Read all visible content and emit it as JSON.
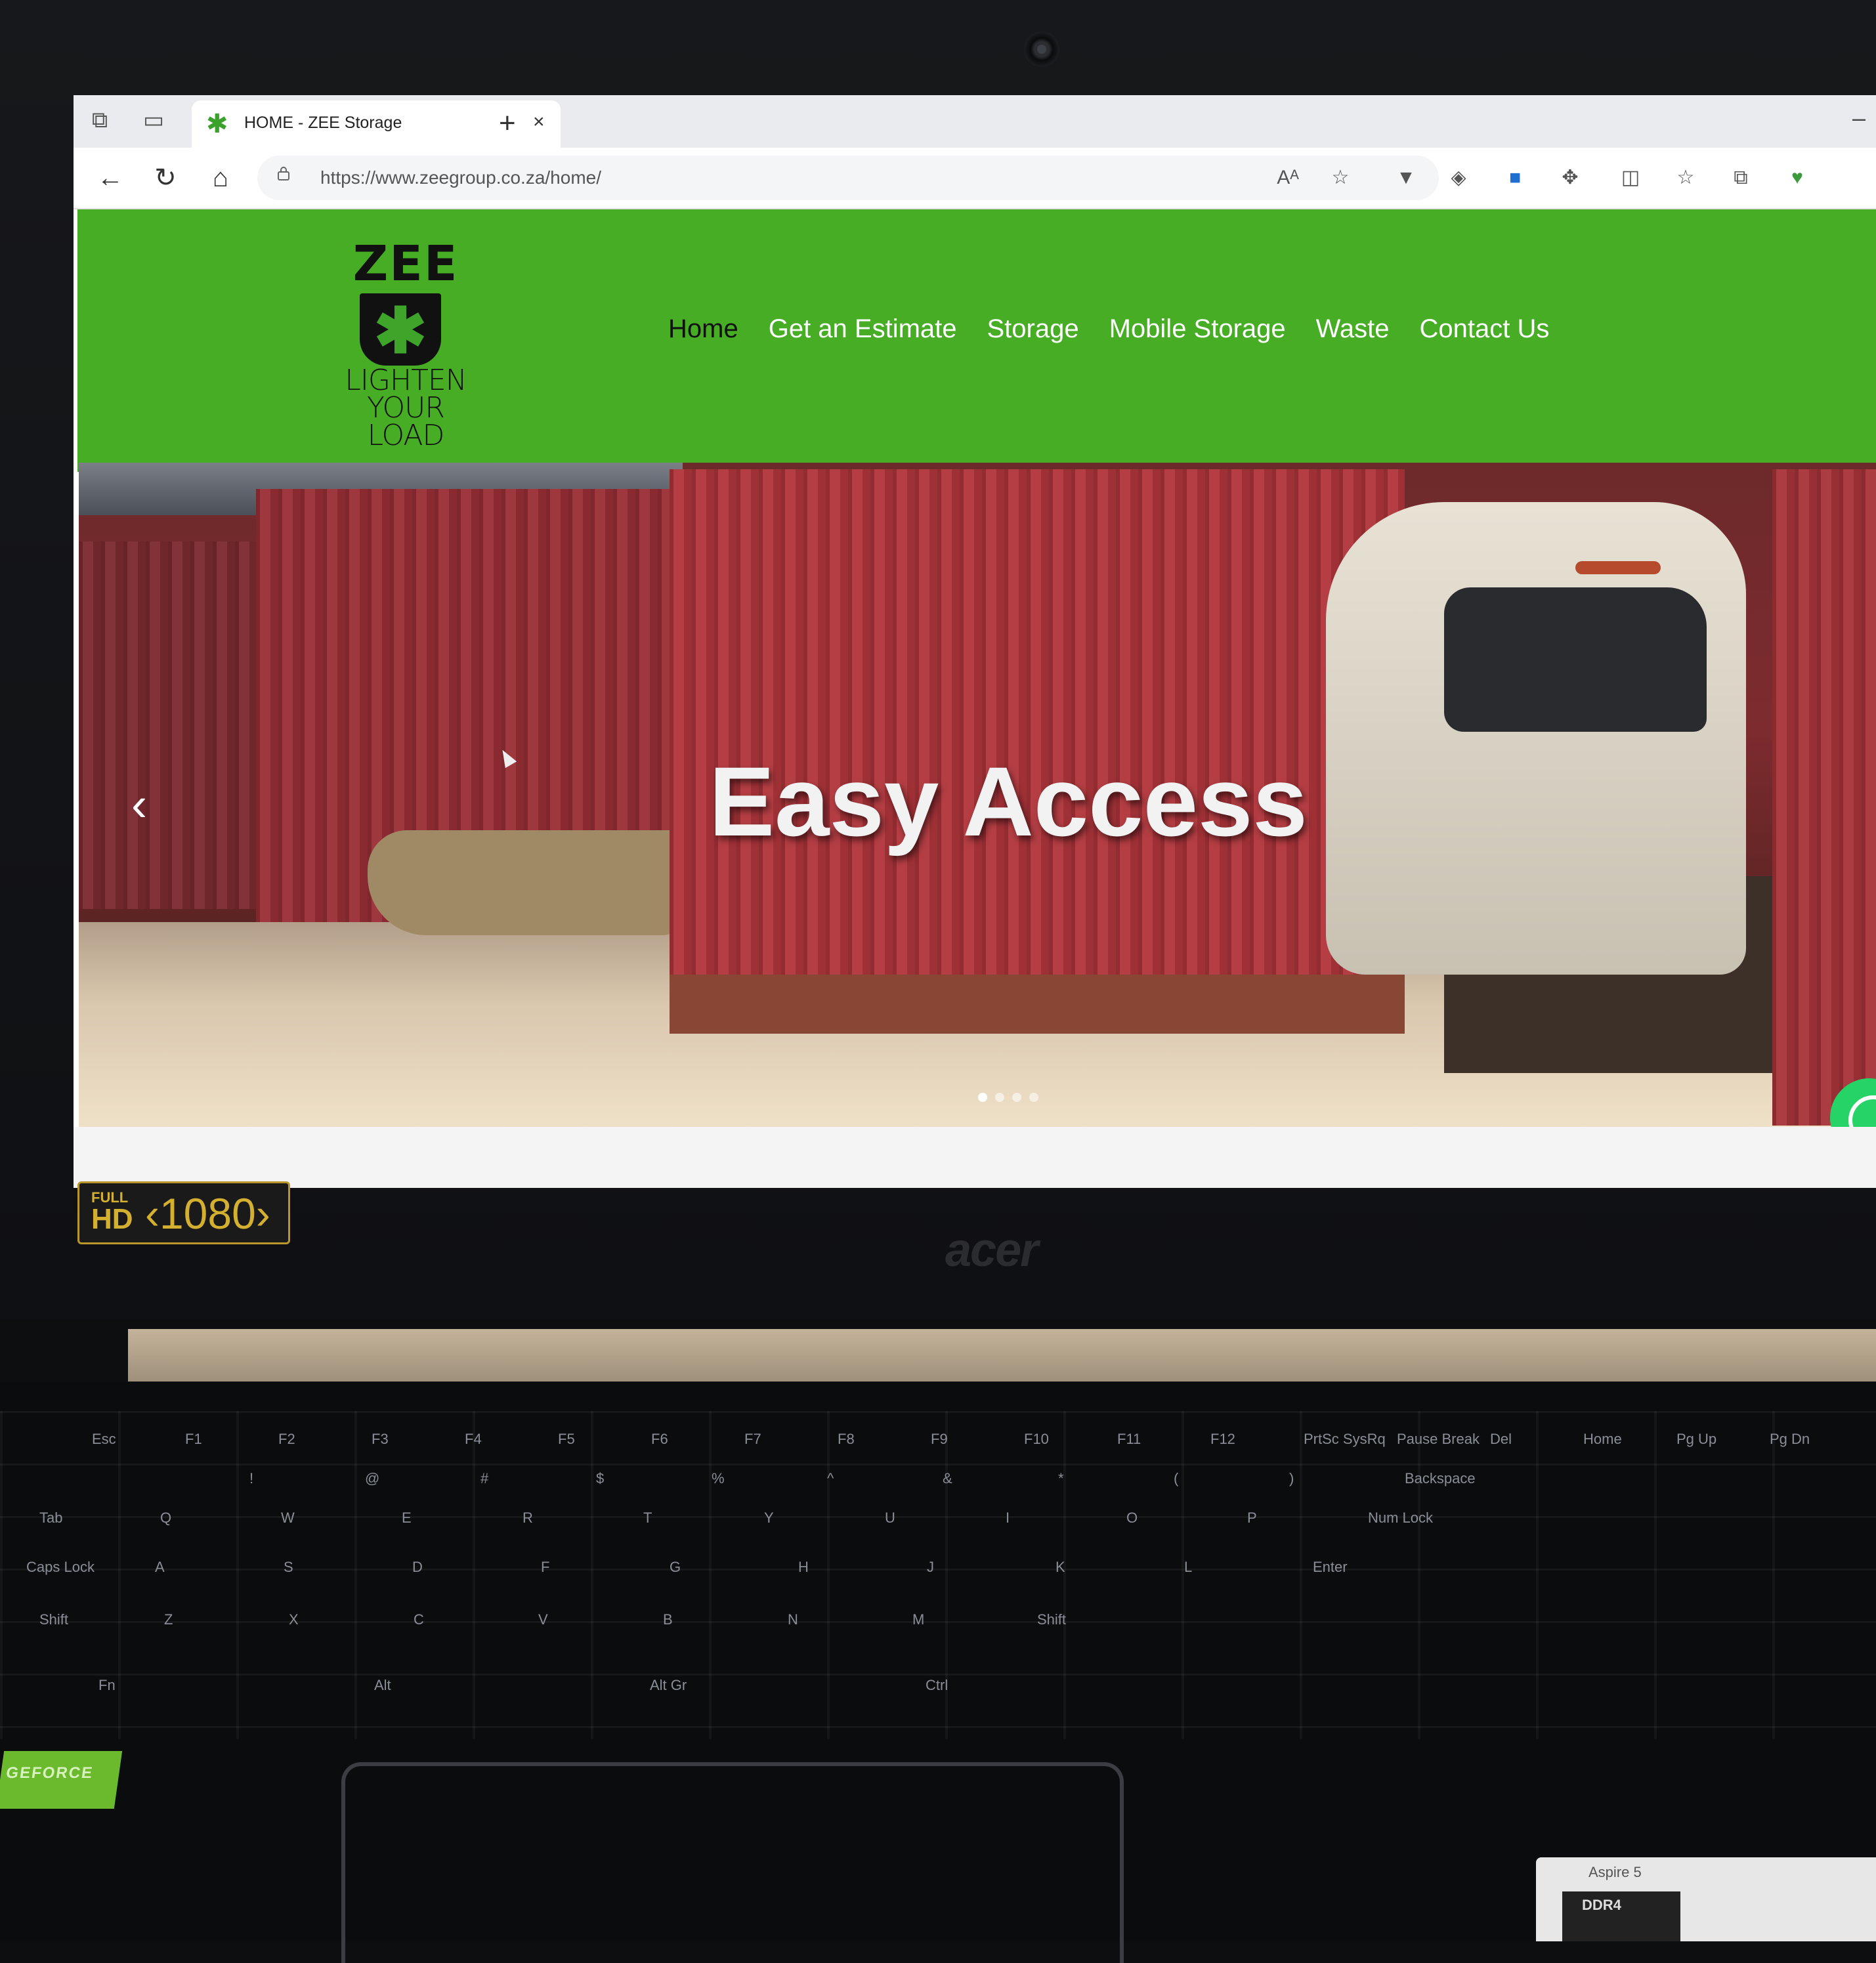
{
  "browser": {
    "tab_title": "HOME - ZEE Storage",
    "tab_close": "×",
    "new_tab": "+",
    "url": "https://www.zeegroup.co.za/home/",
    "icons": [
      "workspaces-icon",
      "tab-actions-icon",
      "back-icon",
      "refresh-icon",
      "home-icon",
      "lock-icon",
      "read-aloud-icon",
      "favorite-star-icon",
      "vivaldi-extension-icon",
      "extension-icon",
      "shield-extension-icon",
      "extensions-icon",
      "split-screen-icon",
      "favorites-icon",
      "collections-icon",
      "heart-extension-icon"
    ]
  },
  "site": {
    "logo": {
      "wordmark": "ZEE",
      "tagline_lines": [
        "LIGHTEN",
        "YOUR",
        "LOAD"
      ]
    },
    "nav": [
      {
        "label": "Home",
        "active": true
      },
      {
        "label": "Get an Estimate",
        "active": false
      },
      {
        "label": "Storage",
        "active": false
      },
      {
        "label": "Mobile Storage",
        "active": false
      },
      {
        "label": "Waste",
        "active": false
      },
      {
        "label": "Contact Us",
        "active": false
      }
    ],
    "hero": {
      "heading": "Easy Access",
      "prev_arrow": "‹",
      "slide_count": 4,
      "active_slide": 1
    },
    "colors": {
      "header_green": "#46ad25",
      "nav_active": "#111111",
      "nav_text": "#ffffff",
      "whatsapp_green": "#25d366"
    }
  },
  "laptop": {
    "sticker_full": "FULL",
    "sticker_hd": "HD",
    "sticker_res": "‹1080›",
    "brand": "acer",
    "geforce": "GEFORCE",
    "aspire": "Aspire 5",
    "ddr4": "DDR4"
  },
  "keyboard": {
    "row_fn": [
      "Esc",
      "F1",
      "F2",
      "F3",
      "F4",
      "F5",
      "F6",
      "F7",
      "F8",
      "F9",
      "F10",
      "F11",
      "F12",
      "PrtSc SysRq",
      "Pause Break",
      "Del",
      "Home",
      "Pg Up",
      "Pg Dn"
    ],
    "row_num": [
      "!",
      "@",
      "#",
      "$",
      "%",
      "^",
      "&",
      "*",
      "(",
      ")",
      "Backspace"
    ],
    "row_q": [
      "Tab",
      "Q",
      "W",
      "E",
      "R",
      "T",
      "Y",
      "U",
      "I",
      "O",
      "P",
      "Num Lock"
    ],
    "row_a": [
      "Caps Lock",
      "A",
      "S",
      "D",
      "F",
      "G",
      "H",
      "J",
      "K",
      "L",
      "Enter"
    ],
    "row_z": [
      "Shift",
      "Z",
      "X",
      "C",
      "V",
      "B",
      "N",
      "M",
      "Shift"
    ],
    "row_bottom": [
      "Fn",
      "Alt",
      "Alt Gr",
      "Ctrl"
    ]
  }
}
